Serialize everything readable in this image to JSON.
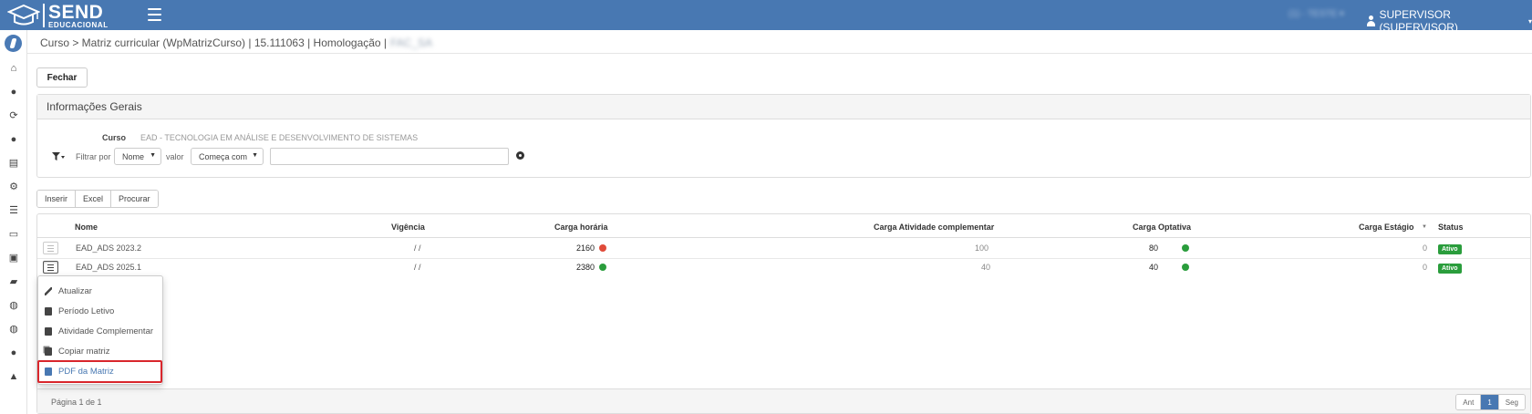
{
  "topbar": {
    "logo_main": "SEND",
    "logo_sub": "EDUCACIONAL",
    "blurred_text": "(1) - TESTE ▾",
    "user_label": "SUPERVISOR (SUPERVISOR)",
    "user_caret": "▾",
    "colors": {
      "background": "#4878b2"
    }
  },
  "sidebar": {
    "items": [
      {
        "icon": "brand-logo-icon"
      },
      {
        "icon": "home-icon",
        "glyph": "⌂"
      },
      {
        "icon": "info-icon",
        "glyph": "●"
      },
      {
        "icon": "loading-icon",
        "glyph": "⟳"
      },
      {
        "icon": "user-icon",
        "glyph": "●"
      },
      {
        "icon": "chart-icon",
        "glyph": "▤"
      },
      {
        "icon": "settings-icon",
        "glyph": "⚙"
      },
      {
        "icon": "list-icon",
        "glyph": "☰"
      },
      {
        "icon": "id-card-icon",
        "glyph": "▭"
      },
      {
        "icon": "calendar-check-icon",
        "glyph": "▣"
      },
      {
        "icon": "inbox-icon",
        "glyph": "▰"
      },
      {
        "icon": "support-icon",
        "glyph": "◍"
      },
      {
        "icon": "support-icon",
        "glyph": "◍"
      },
      {
        "icon": "chat-icon",
        "glyph": "●"
      },
      {
        "icon": "graduation-cap-icon",
        "glyph": "▲"
      }
    ]
  },
  "breadcrumb": {
    "text": "Curso > Matriz curricular (WpMatrizCurso) | 15.111063 | Homologação |",
    "blurred": "FAC_SA"
  },
  "actions": {
    "close_label": "Fechar"
  },
  "info_panel": {
    "title": "Informações Gerais",
    "curso_label": "Curso",
    "curso_value": "EAD - TECNOLOGIA EM ANÁLISE E DESENVOLVIMENTO DE SISTEMAS",
    "filter_label": "Filtrar por",
    "filter_field": "Nome",
    "valor_label": "valor",
    "filter_operator": "Começa com",
    "filter_value": ""
  },
  "toolbar": {
    "insert_label": "Inserir",
    "excel_label": "Excel",
    "search_label": "Procurar"
  },
  "table": {
    "columns": [
      "Nome",
      "Vigência",
      "Carga horária",
      "Carga Atividade complementar",
      "Carga Optativa",
      "Carga Estágio",
      "Status"
    ],
    "rows": [
      {
        "nome": "EAD_ADS 2023.2",
        "vigencia": "/ /",
        "carga_horaria": "2160",
        "carga_horaria_status": "#e04b3a",
        "carga_atividade": "100",
        "carga_optativa": "80",
        "carga_optativa_status": "#2a9d3c",
        "carga_estagio": "0",
        "status": "Ativo"
      },
      {
        "nome": "EAD_ADS 2025.1",
        "vigencia": "/ /",
        "carga_horaria": "2380",
        "carga_horaria_status": "#2a9d3c",
        "carga_atividade": "40",
        "carga_optativa": "40",
        "carga_optativa_status": "#2a9d3c",
        "carga_estagio": "0",
        "status": "Ativo"
      }
    ],
    "page_info": "Página 1 de 1",
    "pager": {
      "prev": "Ant",
      "current": "1",
      "next": "Seg"
    }
  },
  "row_menu": {
    "items": [
      {
        "label": "Atualizar",
        "icon": "pencil-icon"
      },
      {
        "label": "Período Letivo",
        "icon": "calendar-icon"
      },
      {
        "label": "Atividade Complementar",
        "icon": "document-icon"
      },
      {
        "label": "Copiar matriz",
        "icon": "copy-icon"
      },
      {
        "label": "PDF da Matriz",
        "icon": "file-pdf-icon"
      }
    ],
    "highlight_color": "#d9262c"
  }
}
